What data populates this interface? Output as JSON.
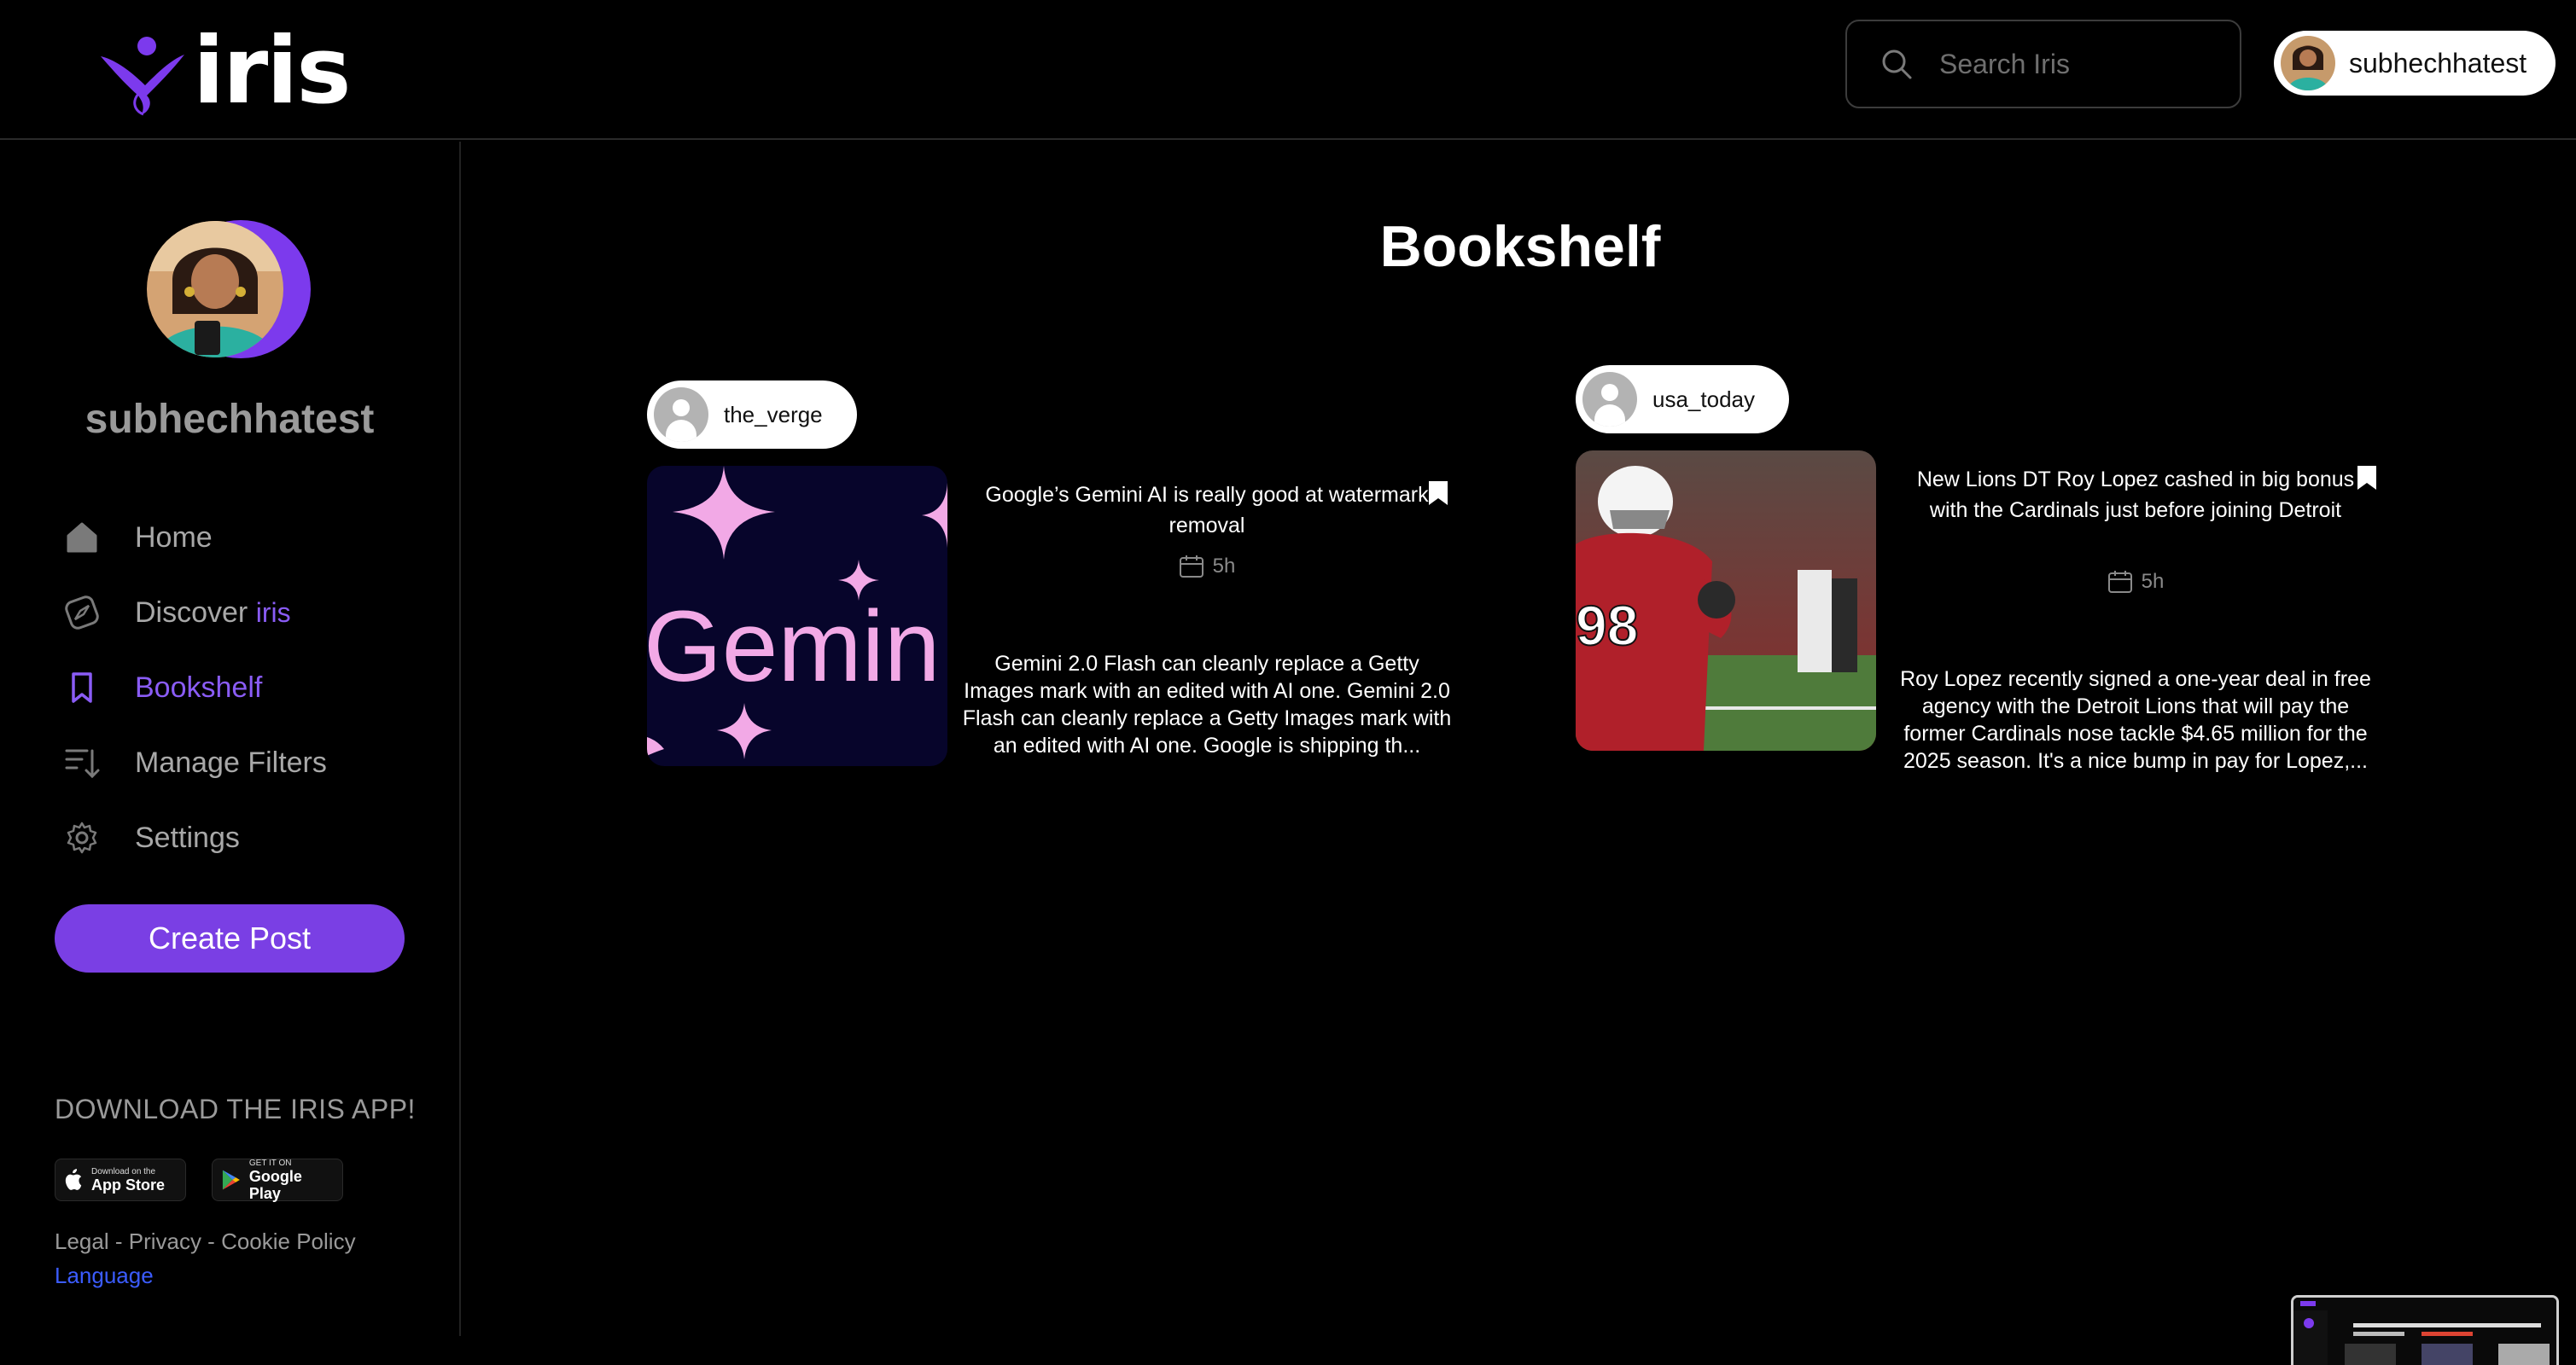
{
  "app": {
    "logo_text": "iris"
  },
  "search": {
    "placeholder": "Search Iris"
  },
  "user": {
    "username": "subhechhatest"
  },
  "sidebar": {
    "profile_name": "subhechhatest",
    "nav": [
      {
        "label": "Home",
        "icon": "home-icon"
      },
      {
        "label": "Discover",
        "accent": "iris",
        "icon": "compass-icon"
      },
      {
        "label": "Bookshelf",
        "icon": "bookmark-icon",
        "active": true
      },
      {
        "label": "Manage Filters",
        "icon": "filter-icon"
      },
      {
        "label": "Settings",
        "icon": "gear-icon"
      }
    ],
    "create_post_label": "Create Post",
    "download_title": "DOWNLOAD THE IRIS APP!",
    "app_store": {
      "small": "Download on the",
      "big": "App Store"
    },
    "google_play": {
      "small": "GET IT ON",
      "big": "Google Play"
    },
    "legal_text": "Legal - Privacy - Cookie Policy",
    "language_label": "Language"
  },
  "main": {
    "title": "Bookshelf",
    "posts": [
      {
        "source": "the_verge",
        "thumb_text": "Gemin",
        "title": "Google’s Gemini AI is really good at watermark removal",
        "time": "5h",
        "body": "Gemini 2.0 Flash can cleanly replace a Getty Images mark with an edited with AI one. Gemini 2.0 Flash can cleanly replace a Getty Images mark with an edited with AI one. Google is shipping th..."
      },
      {
        "source": "usa_today",
        "jersey_text": "98",
        "title": "New Lions DT Roy Lopez cashed in big bonus with the Cardinals just before joining Detroit",
        "time": "5h",
        "body": "Roy Lopez recently signed a one-year deal in free agency with the Detroit Lions that will pay the former Cardinals nose tackle $4.65 million for the 2025 season. It's a nice bump in pay for Lopez,..."
      }
    ]
  },
  "colors": {
    "accent": "#8a5cf6",
    "button": "#7a3fe4",
    "gemini_bg": "#07052b",
    "gemini_pink": "#f2a9e6",
    "link": "#3b5cff"
  }
}
